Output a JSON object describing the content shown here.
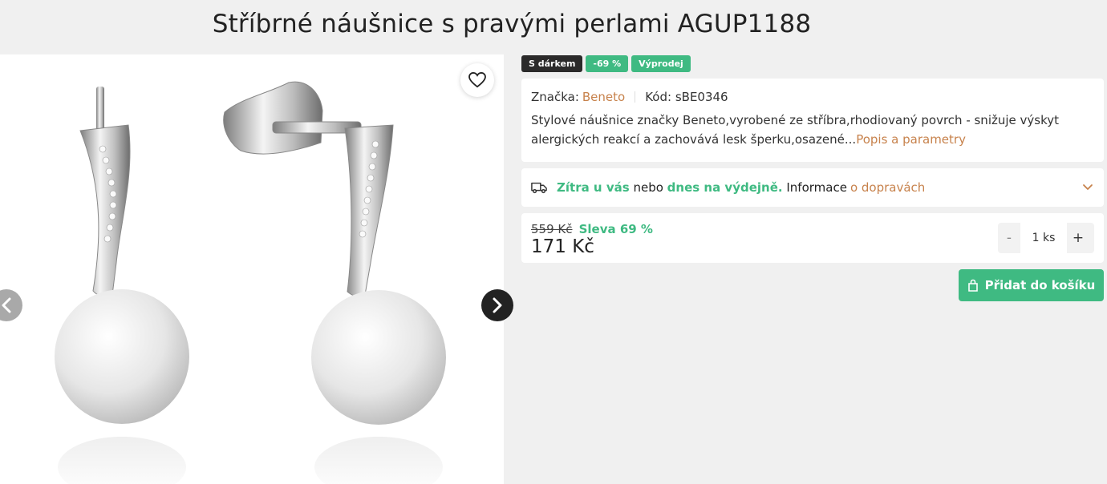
{
  "product": {
    "title": "Stříbrné náušnice s pravými perlami AGUP1188"
  },
  "badges": [
    {
      "label": "S dárkem",
      "color": "#2b2a2a"
    },
    {
      "label": "-69 %",
      "color": "#3fba82"
    },
    {
      "label": "Výprodej",
      "color": "#3fba82"
    }
  ],
  "info": {
    "brand_label": "Značka:",
    "brand_value": "Beneto",
    "code_label": "Kód:",
    "code_value": "sBE0346",
    "description": "Stylové náušnice značky Beneto,vyrobené ze stříbra,rhodiovaný povrch - snižuje výskyt alergických reakcí a zachovává lesk šperku,osazené...",
    "more_link": "Popis a parametry"
  },
  "delivery": {
    "icon": "truck-icon",
    "tomorrow": "Zítra u vás",
    "or": "nebo",
    "today": "dnes na výdejně.",
    "info": "Informace",
    "link": "o dopravách"
  },
  "price": {
    "old": "559 Kč",
    "discount": "Sleva 69 %",
    "current": "171 Kč"
  },
  "quantity": {
    "minus": "-",
    "value": "1 ks",
    "plus": "+"
  },
  "cart": {
    "label": "Přidat do košíku",
    "icon": "shopping-bag-icon"
  },
  "gallery": {
    "wishlist_icon": "heart-icon",
    "prev_icon": "chevron-left-icon",
    "next_icon": "chevron-right-icon"
  },
  "colors": {
    "accent_green": "#3fba82",
    "link_brown": "#c7824c",
    "dark_badge": "#2b2a2a"
  }
}
